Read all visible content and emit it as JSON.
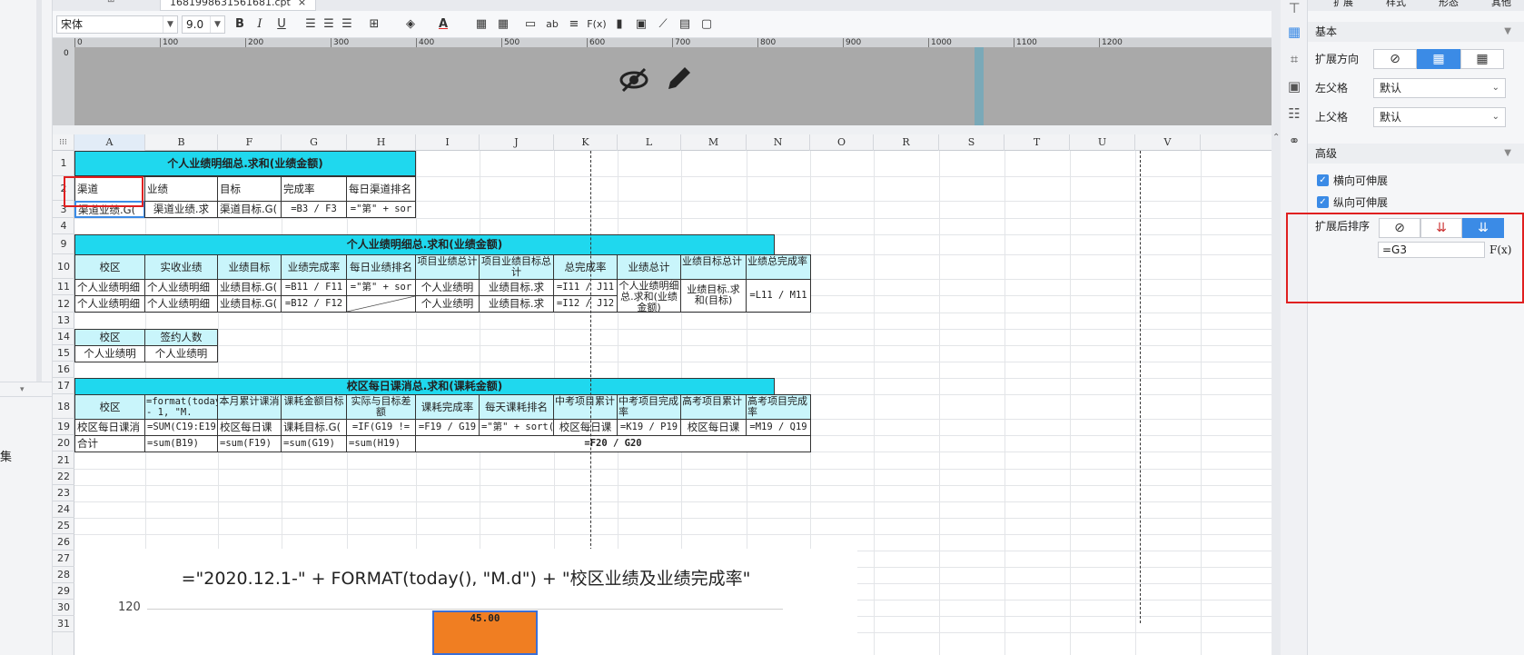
{
  "file_tab": {
    "name": "1681998631561681.cpt",
    "close": "×"
  },
  "toolbar": {
    "font_family": "宋体",
    "font_size": "9.0",
    "bold": "B",
    "italic": "I",
    "underline": "U",
    "text_btn": "ab",
    "fx_btn": "F(x)"
  },
  "ruler": [
    "0",
    "100",
    "200",
    "300",
    "400",
    "500",
    "600",
    "700",
    "800",
    "900",
    "1000",
    "1100",
    "1200"
  ],
  "vruler_label": "0",
  "columns": [
    "A",
    "B",
    "F",
    "G",
    "H",
    "I",
    "J",
    "K",
    "L",
    "M",
    "N",
    "O",
    "R",
    "S",
    "T",
    "U",
    "V"
  ],
  "rows": [
    "1",
    "2",
    "3",
    "4",
    "9",
    "10",
    "11",
    "12",
    "13",
    "14",
    "15",
    "16",
    "17",
    "18",
    "19",
    "20",
    "21",
    "22",
    "23",
    "24",
    "25",
    "26",
    "27",
    "28",
    "29",
    "30",
    "31"
  ],
  "cells": {
    "t1": "个人业绩明细总.求和(业绩金额)",
    "r2": [
      "渠道",
      "业绩",
      "目标",
      "完成率",
      "每日渠道排名"
    ],
    "r3": [
      "渠道业绩.G(",
      "渠道业绩.求",
      "渠道目标.G(",
      "=B3 / F3",
      "=\"第\" + sor"
    ],
    "t9": "个人业绩明细总.求和(业绩金额)",
    "r10": [
      "校区",
      "实收业绩",
      "业绩目标",
      "业绩完成率",
      "每日业绩排名",
      "项目业绩总计",
      "项目业绩目标总计",
      "总完成率",
      "业绩总计",
      "业绩目标总计",
      "业绩总完成率"
    ],
    "r11": [
      "个人业绩明细",
      "个人业绩明细",
      "业绩目标.G(",
      "=B11 / F11",
      "=\"第\" + sor",
      "个人业绩明",
      "业绩目标.求",
      "=I11 / J11",
      "个人业绩明细总.求和(业绩金额)",
      "业绩目标.求和(目标)",
      "=L11 / M11"
    ],
    "r12": [
      "个人业绩明细",
      "个人业绩明细",
      "业绩目标.G(",
      "=B12 / F12",
      "",
      "个人业绩明",
      "业绩目标.求",
      "=I12 / J12"
    ],
    "r14": [
      "校区",
      "签约人数"
    ],
    "r15": [
      "个人业绩明",
      "个人业绩明"
    ],
    "t17": "校区每日课消总.求和(课耗金额)",
    "r18": [
      "校区",
      "=format(today() - 1, \"M.",
      "本月累计课消",
      "课耗金额目标",
      "实际与目标差额",
      "课耗完成率",
      "每天课耗排名",
      "中考项目累计",
      "中考项目完成率",
      "高考项目累计",
      "高考项目完成率"
    ],
    "r19": [
      "校区每日课消",
      "=SUM(C19:E19)",
      "校区每日课",
      "课耗目标.G(",
      "=IF(G19 !=",
      "=F19 / G19",
      "=\"第\" + sort(",
      "校区每日课",
      "=K19 / P19",
      "校区每日课",
      "=M19 / Q19"
    ],
    "r20": [
      "合计",
      "=sum(B19)",
      "=sum(F19)",
      "=sum(G19)",
      "=sum(H19)",
      "=F20 / G20"
    ]
  },
  "chart": {
    "title": "=\"2020.12.1-\" + FORMAT(today(), \"M.d\") + \"校区业绩及业绩完成率\"",
    "y_tick": "120",
    "bar_label": "45.00"
  },
  "left_panel": {
    "dataset_label": "集"
  },
  "right_panel": {
    "tabs": [
      "扩展",
      "样式",
      "形态",
      "其他"
    ],
    "basic_section": "基本",
    "expand_direction_label": "扩展方向",
    "left_parent_label": "左父格",
    "left_parent_value": "默认",
    "up_parent_label": "上父格",
    "up_parent_value": "默认",
    "advanced_section": "高级",
    "horizontal_expand": "横向可伸展",
    "vertical_expand": "纵向可伸展",
    "sort_label": "扩展后排序",
    "sort_formula": "=G3",
    "fx": "F(x)"
  },
  "colors": {
    "header_cyan": "#1fd8ee",
    "cell_cyan": "#c9f5fb",
    "highlight": "#e02020",
    "accent": "#3b8be6"
  }
}
